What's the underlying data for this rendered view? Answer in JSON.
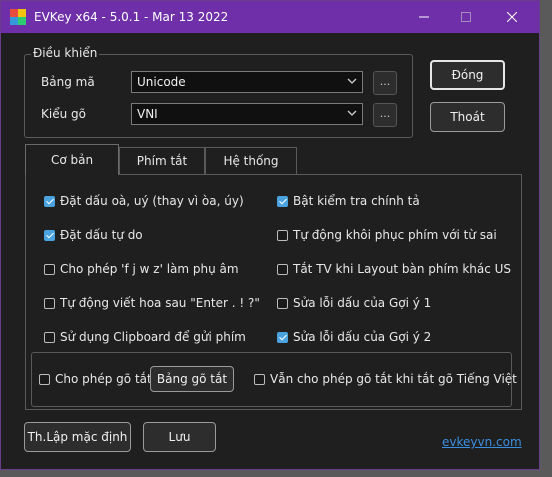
{
  "titlebar": {
    "title": "EVKey x64 - 5.0.1 - Mar 13 2022",
    "icon": "evkey-app-icon",
    "minimize_icon": "minimize-icon",
    "maximize_icon": "maximize-icon",
    "close_icon": "close-icon"
  },
  "control_group": {
    "legend": "Điều khiển",
    "charset": {
      "label": "Bảng mã",
      "value": "Unicode",
      "more": "..."
    },
    "input_method": {
      "label": "Kiểu gõ",
      "value": "VNI",
      "more": "..."
    }
  },
  "buttons": {
    "close": "Đóng",
    "exit": "Thoát",
    "reset_default": "Th.Lập mặc định",
    "save": "Lưu"
  },
  "tabs": [
    {
      "label": "Cơ bản"
    },
    {
      "label": "Phím tắt"
    },
    {
      "label": "Hệ thống"
    }
  ],
  "options": [
    {
      "label": "Đặt dấu oà, uý (thay vì òa, úy)",
      "checked": true
    },
    {
      "label": "Bật kiểm tra chính tả",
      "checked": true
    },
    {
      "label": "Đặt dấu tự do",
      "checked": true
    },
    {
      "label": "Tự động khôi phục phím với từ sai",
      "checked": false
    },
    {
      "label": "Cho phép 'f j w z' làm phụ âm",
      "checked": false
    },
    {
      "label": "Tắt TV khi Layout bàn phím khác US",
      "checked": false
    },
    {
      "label": "Tự động viết hoa sau \"Enter . ! ?\"",
      "checked": false
    },
    {
      "label": "Sửa lỗi dấu của Gợi ý 1",
      "checked": false
    },
    {
      "label": "Sử dụng Clipboard để gửi phím",
      "checked": false
    },
    {
      "label": "Sửa lỗi dấu của Gợi ý 2",
      "checked": true
    }
  ],
  "shortcut": {
    "allow_label": "Cho phép gõ tắt",
    "allow_checked": false,
    "table_button": "Bảng gõ tắt",
    "keep_label": "Vẫn cho phép gõ tắt khi tắt gõ Tiếng Việt",
    "keep_checked": false
  },
  "footer": {
    "link": "evkeyvn.com"
  },
  "colors": {
    "titlebar": "#6e2fa8",
    "checked": "#4aa3df",
    "link": "#3b8fe0"
  }
}
